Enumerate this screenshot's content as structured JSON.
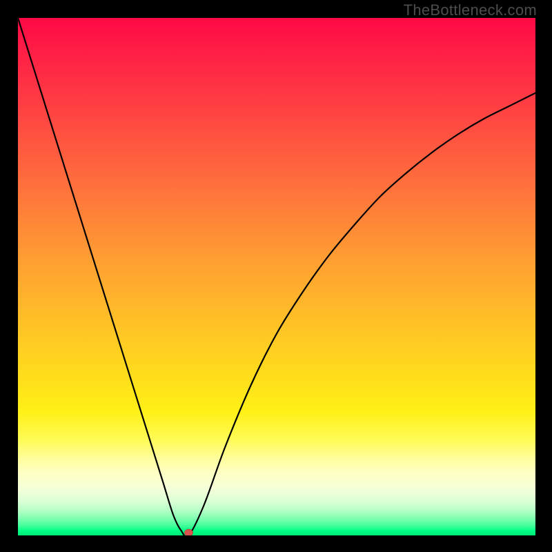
{
  "watermark": "TheBottleneck.com",
  "chart_data": {
    "type": "line",
    "title": "",
    "xlabel": "",
    "ylabel": "",
    "xlim": [
      0,
      100
    ],
    "ylim": [
      0,
      100
    ],
    "grid": false,
    "legend": false,
    "background_gradient": {
      "top_color": "#ff0945",
      "bottom_color": "#00e878",
      "meaning": "top = high bottleneck / bad, bottom = low bottleneck / good"
    },
    "series": [
      {
        "name": "bottleneck-curve",
        "x": [
          0,
          5,
          10,
          15,
          20,
          25,
          28,
          30,
          31.5,
          33,
          36,
          40,
          45,
          50,
          55,
          60,
          65,
          70,
          75,
          80,
          85,
          90,
          95,
          100
        ],
        "y": [
          100,
          84,
          68,
          52,
          36,
          20,
          10.4,
          4,
          1,
          0,
          6,
          17,
          29,
          39,
          47,
          54,
          60,
          65.5,
          70,
          74,
          77.5,
          80.5,
          83,
          85.5
        ]
      }
    ],
    "marker": {
      "name": "optimal-point",
      "x": 33,
      "y": 0,
      "color": "#d9534f"
    }
  }
}
